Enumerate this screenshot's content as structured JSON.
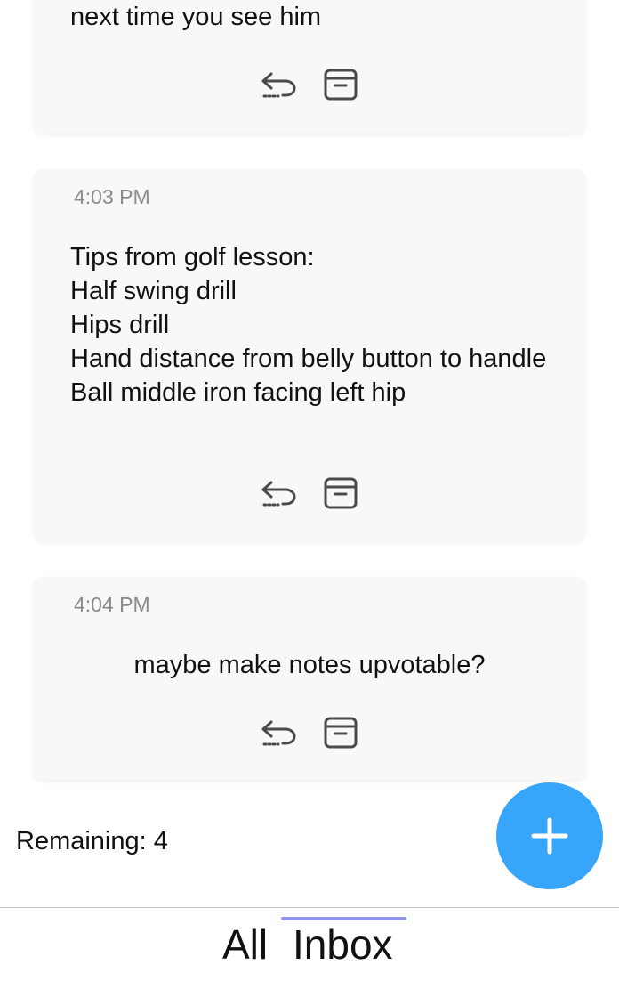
{
  "notes": [
    {
      "time": "",
      "text": "next time you see him"
    },
    {
      "time": "4:03 PM",
      "text": "Tips from golf lesson:\nHalf swing drill\nHips drill\nHand distance from belly button to handle\nBall middle iron facing left hip"
    },
    {
      "time": "4:04 PM",
      "text": "maybe make notes upvotable?"
    }
  ],
  "icons": {
    "reply": "reply-icon",
    "archive": "archive-icon",
    "add": "plus-icon"
  },
  "footer": {
    "remaining_label": "Remaining: 4"
  },
  "tabs": {
    "all": "All",
    "inbox": "Inbox",
    "active": "Inbox"
  },
  "colors": {
    "fab": "#36a5fa",
    "tab_indicator": "#8f93ec",
    "card_bg": "#f8f8f8",
    "muted_text": "#8a8a8a"
  }
}
